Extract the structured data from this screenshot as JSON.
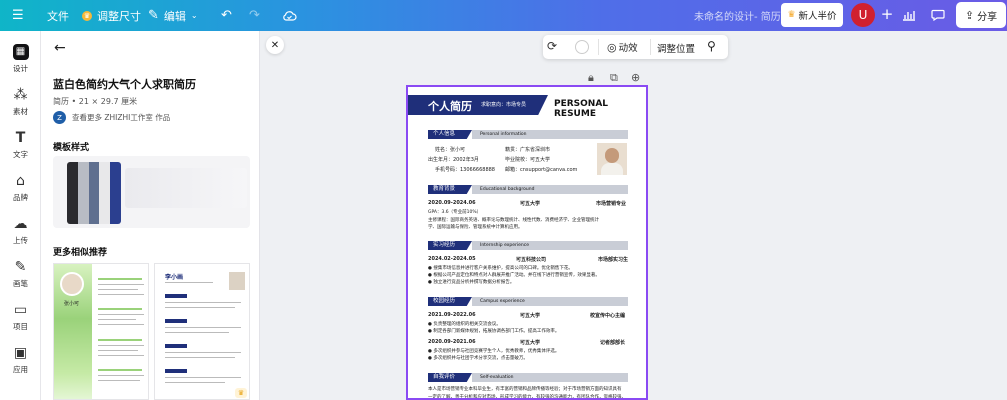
{
  "topbar": {
    "file_label": "文件",
    "resize_label": "调整尺寸",
    "edit_label": "编辑",
    "doc_title": "未命名的设计- 简历",
    "promo_label": "新人半价",
    "avatar_letter": "U",
    "share_label": "分享"
  },
  "rail": [
    {
      "label": "设计"
    },
    {
      "label": "素材"
    },
    {
      "label": "文字"
    },
    {
      "label": "品牌"
    },
    {
      "label": "上传"
    },
    {
      "label": "画笔"
    },
    {
      "label": "项目"
    },
    {
      "label": "应用"
    }
  ],
  "panel": {
    "title": "蓝白色简约大气个人求职简历",
    "size": "简历 • 21 × 29.7 厘米",
    "author_initial": "Z",
    "author_text": "查看更多 ZHIZHI工作室 作品",
    "styles_heading": "模板样式",
    "similar_heading": "更多相似推荐",
    "swatch_colors": [
      "#2a2a2e",
      "#b8bcc4",
      "#5f6f8f",
      "#e8e8ea",
      "#2b3f8f"
    ],
    "thumb1_name": "张小可",
    "thumb2_name": "李小画"
  },
  "toolbar": {
    "effects_label": "动效",
    "position_label": "调整位置"
  },
  "resume": {
    "header_name": "个人简历",
    "header_intention": "求职意向：市场专员",
    "header_en": "PERSONAL RESUME",
    "sections": [
      {
        "cn": "个人信息",
        "en": "Personal information"
      },
      {
        "cn": "教育背景",
        "en": "Educational background"
      },
      {
        "cn": "实习经历",
        "en": "Internship experience"
      },
      {
        "cn": "校园经历",
        "en": "Campus experience"
      },
      {
        "cn": "自我评价",
        "en": "Self-evaluation"
      }
    ],
    "info": {
      "name": "姓名：张小可",
      "birth": "出生年月：2002年3月",
      "phone": "手机号码：13066668888",
      "location": "籍贯：广东省深圳市",
      "school": "毕业院校：可五大学",
      "email": "邮箱：cnsupport@canva.com"
    },
    "edu": {
      "period": "2020.09-2024.06",
      "school": "可五大学",
      "major": "市场营销专业",
      "gpa": "GPA：3.6（专业前10%）",
      "courses1": "主修课程：国际商务英语、概率论与数理统计、线性代数、消费经济学、企业管理统计",
      "courses2": "学、国际运输与保险、管理系统中计算机应用。"
    },
    "intern": {
      "period": "2024.02-2024.05",
      "company": "可五科技公司",
      "role": "市场部实习生",
      "b1": "● 搜集市场信息并进行客户关系维护，提高公司的口碑。优化销售下花。",
      "b2": "● 根据公司产品定位和特点对人群展开推广活动。并在线下进行营销宣传，效果显著。",
      "b3": "● 独立进行竞品分析并撰写数据分析报告。"
    },
    "campus": [
      {
        "period": "2021.09-2022.06",
        "org": "可五大学",
        "role": "校宣传中心主编"
      },
      {
        "period": "2020.09-2021.06",
        "org": "可五大学",
        "role": "记者部部长"
      }
    ],
    "campus_b1": "● 负责整理的组织的相关交流会议。",
    "campus_b2": "● 制定各部门新媒体规划，拓展协调各部门工作。提高工作效率。",
    "campus_b3": "● 多次组织并参与社团竞赛学生个人，优秀教师，优秀集体评选。",
    "campus_b4": "● 多次组织并与社团学术分享交流，点击量破万。",
    "self1": "本人是市场营销专业本科毕业生，有丰富的营销和品牌传播等经验；对于市场营销方面的知识具有",
    "self2": "一定的了解，善于分析和应对市场，形成学习的能力，有较强的沟通能力，有团队合作，资格较强、"
  }
}
